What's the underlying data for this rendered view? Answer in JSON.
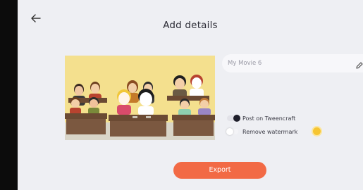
{
  "page": {
    "title": "Add details",
    "back_icon": "arrow-left-icon"
  },
  "video": {
    "name": "My Movie 6",
    "edit_icon": "pencil-icon"
  },
  "options": [
    {
      "label": "Post on Tweencraft",
      "on": true
    },
    {
      "label": "Remove watermark",
      "on": false,
      "premium_icon": "coin-icon"
    }
  ],
  "export": {
    "label": "Export"
  },
  "colors": {
    "accent": "#f26a45",
    "background": "#eeeff3",
    "thumbnail_bg": "#f4e08e",
    "coin": "#f6c532"
  }
}
